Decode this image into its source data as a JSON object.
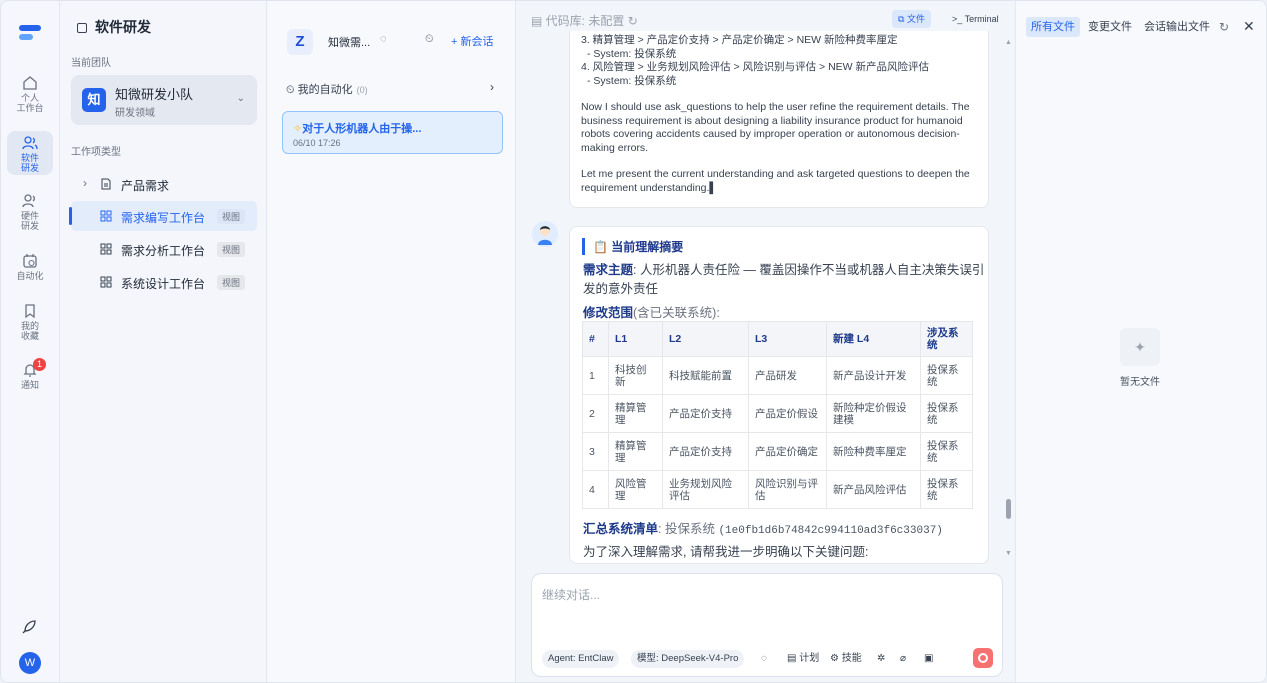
{
  "rail": {
    "items": [
      {
        "label_1": "个人",
        "label_2": "工作台"
      },
      {
        "label_1": "软件",
        "label_2": "研发"
      },
      {
        "label_1": "硬件",
        "label_2": "研发"
      },
      {
        "label_1": "自动化",
        "label_2": ""
      },
      {
        "label_1": "我的",
        "label_2": "收藏"
      },
      {
        "label_1": "通知",
        "label_2": ""
      }
    ],
    "notify_count": "1",
    "user_initial": "W"
  },
  "panel": {
    "title": "软件研发",
    "team_label": "当前团队",
    "team_logo": "知",
    "team_name": "知微研发小队",
    "team_sub": "研发领域",
    "worktype_label": "工作项类型",
    "tree": [
      {
        "label": "产品需求"
      },
      {
        "label": "需求编写工作台",
        "tag": "视图"
      },
      {
        "label": "需求分析工作台",
        "tag": "视图"
      },
      {
        "label": "系统设计工作台",
        "tag": "视图"
      }
    ]
  },
  "sessions": {
    "logo": "Z",
    "name": "知微需...",
    "new_label": "+ 新会话",
    "my_auto": "我的自动化",
    "my_auto_count": "(0)",
    "card_title": "对于人形机器人由于操...",
    "card_time": "06/10 17:26"
  },
  "chat": {
    "repo": "代码库: 未配置",
    "file_btn": "文件",
    "terminal_btn": "Terminal",
    "msg1_lines": [
      "3. 精算管理 > 产品定价支持 > 产品定价确定 > NEW 新险种费率厘定",
      "   - System: 投保系统",
      "4. 风险管理 > 业务规划风险评估 > 风险识别与评估 > NEW 新产品风险评估",
      "   - System: 投保系统",
      "",
      "Now I should use ask_questions to help the user refine the requirement details. The business requirement is about designing a liability insurance product for humanoid robots covering accidents caused by improper operation or autonomous decision-making errors.",
      "",
      "Let me present the current understanding and ask targeted questions to deepen the requirement understanding."
    ],
    "summary_title": "当前理解摘要",
    "topic_label": "需求主题",
    "topic_text": ": 人形机器人责任险 — 覆盖因操作不当或机器人自主决策失误引发的意外责任",
    "scope_label": "修改范围",
    "scope_text": "(含已关联系统):",
    "table": {
      "headers": [
        "#",
        "L1",
        "L2",
        "L3",
        "新建 L4",
        "涉及系统"
      ],
      "rows": [
        [
          "1",
          "科技创新",
          "科技赋能前置",
          "产品研发",
          "新产品设计开发",
          "投保系统"
        ],
        [
          "2",
          "精算管理",
          "产品定价支持",
          "产品定价假设",
          "新险种定价假设建模",
          "投保系统"
        ],
        [
          "3",
          "精算管理",
          "产品定价支持",
          "产品定价确定",
          "新险种费率厘定",
          "投保系统"
        ],
        [
          "4",
          "风险管理",
          "业务规划风险评估",
          "风险识别与评估",
          "新产品风险评估",
          "投保系统"
        ]
      ]
    },
    "system_list_label": "汇总系统清单",
    "system_list_text": ": 投保系统",
    "system_hash": "(1e0fb1d6b74842c994110ad3f6c33037)",
    "question_intro": "为了深入理解需求, 请帮我进一步明确以下关键问题:",
    "composer_placeholder": "继续对话...",
    "agent_chip": "Agent: EntClaw",
    "model_chip": "模型: DeepSeek-V4-Pro",
    "plan_label": "计划",
    "skill_label": "技能"
  },
  "files": {
    "tabs": [
      "所有文件",
      "变更文件",
      "会话输出文件"
    ],
    "empty": "暂无文件"
  }
}
